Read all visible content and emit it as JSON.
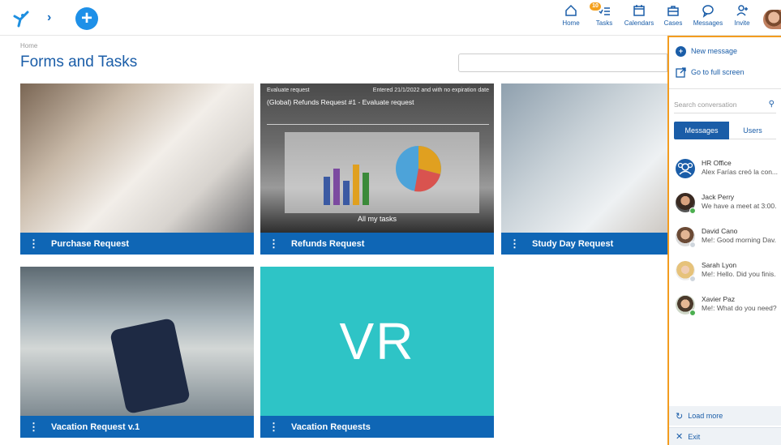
{
  "topbar": {
    "nav": [
      {
        "label": "Home",
        "icon": "home-icon"
      },
      {
        "label": "Tasks",
        "icon": "tasks-icon",
        "badge": "10"
      },
      {
        "label": "Calendars",
        "icon": "calendar-icon"
      },
      {
        "label": "Cases",
        "icon": "briefcase-icon"
      },
      {
        "label": "Messages",
        "icon": "chat-icon"
      },
      {
        "label": "Invite",
        "icon": "invite-user-icon"
      }
    ],
    "add_symbol": "+",
    "chevron": "›"
  },
  "breadcrumb": "Home",
  "page_title": "Forms and Tasks",
  "cards": [
    {
      "label": "Purchase Request"
    },
    {
      "label": "Refunds Request",
      "overlay": {
        "kind": "Evaluate request",
        "date": "Entered 21/1/2022 and with no expiration date",
        "title": "(Global) Refunds Request #1 - Evaluate request",
        "footer": "All my tasks"
      }
    },
    {
      "label": "Study Day Request"
    },
    {
      "label": "Vacation Request v.1"
    },
    {
      "label": "Vacation Requests",
      "initials": "VR"
    }
  ],
  "panel": {
    "new_message": "New message",
    "full_screen": "Go to full screen",
    "search_placeholder": "Search conversation",
    "tabs": [
      "Messages",
      "Users"
    ],
    "conversations": [
      {
        "name": "HR Office",
        "preview": "Alex Farías creó la con..."
      },
      {
        "name": "Jack Perry",
        "preview": "We have a meet at 3:00.",
        "status": "online"
      },
      {
        "name": "David Cano",
        "preview": "Me!: Good morning Dav.",
        "status": "offline"
      },
      {
        "name": "Sarah Lyon",
        "preview": "Me!: Hello. Did you finis.",
        "status": "offline"
      },
      {
        "name": "Xavier Paz",
        "preview": "Me!: What do you need?",
        "status": "online"
      }
    ],
    "load_more": "Load more",
    "exit": "Exit"
  },
  "colors": {
    "accent": "#0f66b5",
    "panel_border": "#f39c1f",
    "vr_tile": "#2ec4c6",
    "online": "#4caf50",
    "offline": "#cfd6dd"
  }
}
